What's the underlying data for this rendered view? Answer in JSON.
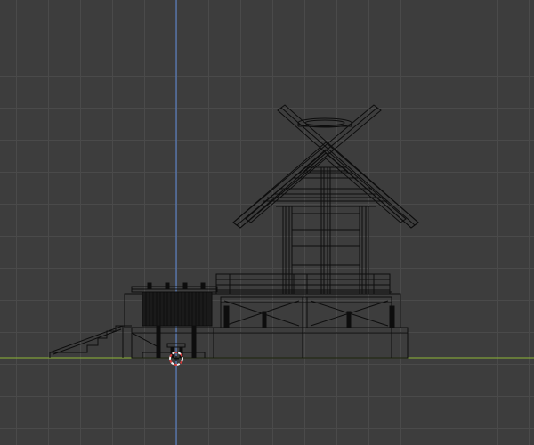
{
  "viewport": {
    "view": "front-orthographic",
    "mode": "wireframe",
    "colors": {
      "background": "#3d3d3d",
      "grid_line": "#4a4a4a",
      "x_axis": "#7fa03a",
      "z_axis": "#5a7fc0",
      "wire": "#0d0d0d",
      "cursor_red": "#d23a3a",
      "cursor_white": "#f0f0f0"
    }
  },
  "scene": {
    "object": "shrine-building",
    "parts": [
      "chigi-crossed-rafters",
      "katsuogi-roof-ornament",
      "gable-roof",
      "pillars",
      "veranda-railing",
      "stone-foundation",
      "entry-stairs",
      "gate-structure"
    ]
  },
  "cursor": {
    "icon": "3d-cursor-icon"
  }
}
